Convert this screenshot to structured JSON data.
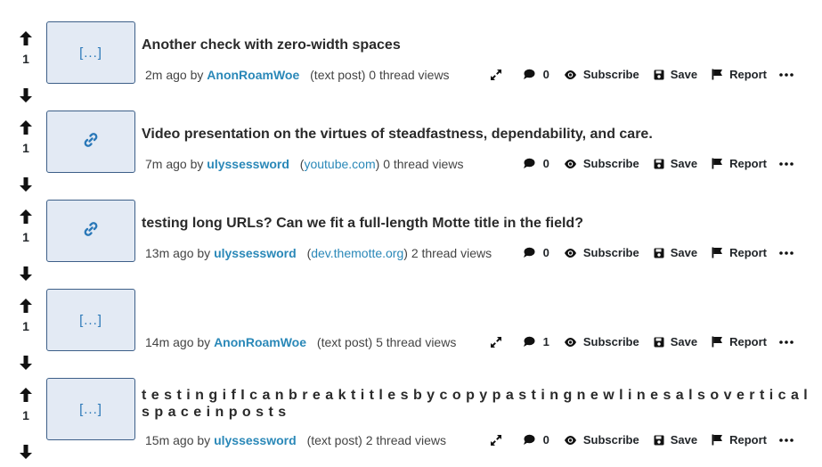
{
  "posts": [
    {
      "score": "1",
      "thumb": "[...]",
      "thumb_type": "text",
      "title": "Another check with zero-width spaces",
      "time": "2m ago",
      "by": "by",
      "author": "AnonRoamWoe",
      "source": "(text post)",
      "views": "0 thread views",
      "comments": "0",
      "has_expand": true
    },
    {
      "score": "1",
      "thumb": "",
      "thumb_type": "link",
      "title": "Video presentation on the virtues of steadfastness, dependability, and care.",
      "time": "7m ago",
      "by": "by",
      "author": "ulyssessword",
      "source": "youtube.com",
      "views": "0 thread views",
      "comments": "0",
      "has_expand": false
    },
    {
      "score": "1",
      "thumb": "",
      "thumb_type": "link",
      "title": "testing long URLs? Can we fit a full-length Motte title in the field?",
      "time": "13m ago",
      "by": "by",
      "author": "ulyssessword",
      "source": "dev.themotte.org",
      "views": "2 thread views",
      "comments": "0",
      "has_expand": false
    },
    {
      "score": "1",
      "thumb": "[...]",
      "thumb_type": "text",
      "title": "",
      "time": "14m ago",
      "by": "by",
      "author": "AnonRoamWoe",
      "source": "(text post)",
      "views": "5 thread views",
      "comments": "1",
      "has_expand": true
    },
    {
      "score": "1",
      "thumb": "[...]",
      "thumb_type": "text",
      "title": "t e s t i n g i f I c a n b r e a k t i t l e s b y c o p y p a s t i n g n e w l i n e s a l s o v e r t i c a l s p a c e i n p o s t s",
      "time": "15m ago",
      "by": "by",
      "author": "ulyssessword",
      "source": "(text post)",
      "views": "2 thread views",
      "comments": "0",
      "has_expand": true
    }
  ],
  "actions": {
    "subscribe": "Subscribe",
    "save": "Save",
    "report": "Report"
  },
  "colors": {
    "link": "#2a88b8",
    "thumb_bg": "#e3eaf4",
    "thumb_border": "#3d5f88"
  },
  "icons": [
    "arrow-up-icon",
    "arrow-down-icon",
    "link-icon",
    "expand-icon",
    "comment-icon",
    "eye-icon",
    "save-icon",
    "flag-icon",
    "more-icon"
  ]
}
